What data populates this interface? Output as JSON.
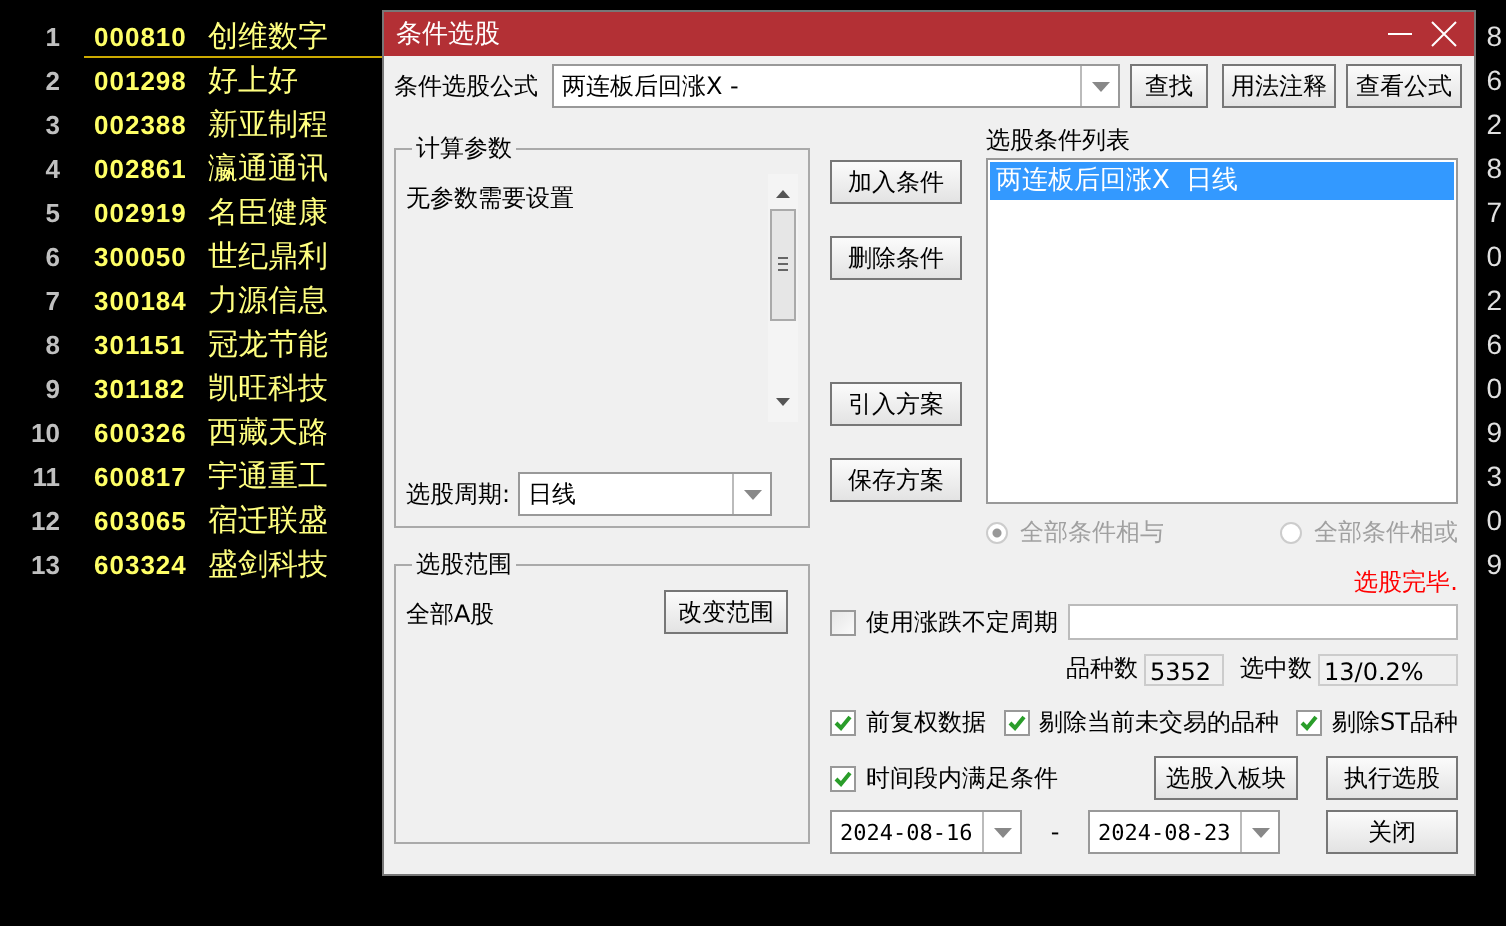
{
  "stock_list": {
    "rows": [
      {
        "index": "1",
        "code": "000810",
        "name": "创维数字",
        "column_3": "8",
        "selected": true
      },
      {
        "index": "2",
        "code": "001298",
        "name": "好上好",
        "column_3": "6",
        "selected": false
      },
      {
        "index": "3",
        "code": "002388",
        "name": "新亚制程",
        "column_3": "2",
        "selected": false
      },
      {
        "index": "4",
        "code": "002861",
        "name": "瀛通通讯",
        "column_3": "8",
        "selected": false
      },
      {
        "index": "5",
        "code": "002919",
        "name": "名臣健康",
        "column_3": "7",
        "selected": false
      },
      {
        "index": "6",
        "code": "300050",
        "name": "世纪鼎利",
        "column_3": "0",
        "selected": false
      },
      {
        "index": "7",
        "code": "300184",
        "name": "力源信息",
        "column_3": "2",
        "selected": false
      },
      {
        "index": "8",
        "code": "301151",
        "name": "冠龙节能",
        "column_3": "6",
        "selected": false
      },
      {
        "index": "9",
        "code": "301182",
        "name": "凯旺科技",
        "column_3": "0",
        "selected": false
      },
      {
        "index": "10",
        "code": "600326",
        "name": "西藏天路",
        "column_3": "9",
        "selected": false
      },
      {
        "index": "11",
        "code": "600817",
        "name": "宇通重工",
        "column_3": "3",
        "selected": false
      },
      {
        "index": "12",
        "code": "603065",
        "name": "宿迁联盛",
        "column_3": "0",
        "selected": false
      },
      {
        "index": "13",
        "code": "603324",
        "name": "盛剑科技",
        "column_3": "9",
        "selected": false
      }
    ]
  },
  "dialog": {
    "title": "条件选股",
    "formula": {
      "label": "条件选股公式",
      "value": "两连板后回涨X -"
    },
    "top_buttons": [
      "查找",
      "用法注释",
      "查看公式"
    ],
    "params_group": {
      "title": "计算参数",
      "text": "无参数需要设置",
      "period_label": "选股周期:",
      "period_value": "日线"
    },
    "action_buttons": [
      "加入条件",
      "删除条件",
      "引入方案",
      "保存方案"
    ],
    "conditions": {
      "title": "选股条件列表",
      "items": [
        {
          "text": "两连板后回涨X  日线",
          "selected": true
        }
      ]
    },
    "logic_options": [
      {
        "label": "全部条件相与",
        "selected": true,
        "disabled": true
      },
      {
        "label": "全部条件相或",
        "selected": false,
        "disabled": true
      }
    ],
    "status": "选股完毕.",
    "range_group": {
      "title": "选股范围",
      "value": "全部A股",
      "button": "改变范围"
    },
    "variable_period": {
      "label": "使用涨跌不定周期",
      "checked": false
    },
    "counts": [
      {
        "label": "品种数",
        "value": "5352"
      },
      {
        "label": "选中数",
        "value": "13/0.2%"
      }
    ],
    "options": [
      {
        "label": "前复权数据",
        "checked": true
      },
      {
        "label": "剔除当前未交易的品种",
        "checked": true
      },
      {
        "label": "剔除ST品种",
        "checked": true
      }
    ],
    "time_range": {
      "label": "时间段内满足条件",
      "checked": true,
      "start": "2024-08-16",
      "separator": "-",
      "end": "2024-08-23"
    },
    "bottom_buttons": [
      "选股入板块",
      "执行选股",
      "关闭"
    ]
  }
}
